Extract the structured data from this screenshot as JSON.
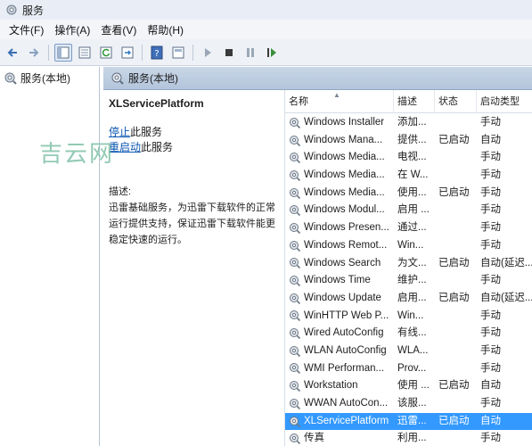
{
  "window": {
    "title": "服务"
  },
  "menu": [
    "文件(F)",
    "操作(A)",
    "查看(V)",
    "帮助(H)"
  ],
  "tree": {
    "root_label": "服务(本地)"
  },
  "pane_header": {
    "label": "服务(本地)"
  },
  "detail": {
    "service_name": "XLServicePlatform",
    "stop_link": "停止",
    "stop_suffix": "此服务",
    "restart_link": "重启动",
    "restart_suffix": "此服务",
    "desc_label": "描述:",
    "desc_text": "迅雷基础服务，为迅雷下载软件的正常运行提供支持，保证迅雷下载软件能更稳定快速的运行。"
  },
  "watermark": "吉云网",
  "table": {
    "columns": {
      "name": "名称",
      "desc": "描述",
      "status": "状态",
      "type": "启动类型"
    },
    "rows": [
      {
        "name": "Windows Installer",
        "desc": "添加...",
        "status": "",
        "type": "手动"
      },
      {
        "name": "Windows Mana...",
        "desc": "提供...",
        "status": "已启动",
        "type": "自动"
      },
      {
        "name": "Windows Media...",
        "desc": "电视...",
        "status": "",
        "type": "手动"
      },
      {
        "name": "Windows Media...",
        "desc": "在 W...",
        "status": "",
        "type": "手动"
      },
      {
        "name": "Windows Media...",
        "desc": "使用...",
        "status": "已启动",
        "type": "手动"
      },
      {
        "name": "Windows Modul...",
        "desc": "启用 ...",
        "status": "",
        "type": "手动"
      },
      {
        "name": "Windows Presen...",
        "desc": "通过...",
        "status": "",
        "type": "手动"
      },
      {
        "name": "Windows Remot...",
        "desc": "Win...",
        "status": "",
        "type": "手动"
      },
      {
        "name": "Windows Search",
        "desc": "为文...",
        "status": "已启动",
        "type": "自动(延迟..."
      },
      {
        "name": "Windows Time",
        "desc": "维护...",
        "status": "",
        "type": "手动"
      },
      {
        "name": "Windows Update",
        "desc": "启用...",
        "status": "已启动",
        "type": "自动(延迟..."
      },
      {
        "name": "WinHTTP Web P...",
        "desc": "Win...",
        "status": "",
        "type": "手动"
      },
      {
        "name": "Wired AutoConfig",
        "desc": "有线...",
        "status": "",
        "type": "手动"
      },
      {
        "name": "WLAN AutoConfig",
        "desc": "WLA...",
        "status": "",
        "type": "手动"
      },
      {
        "name": "WMI Performan...",
        "desc": "Prov...",
        "status": "",
        "type": "手动"
      },
      {
        "name": "Workstation",
        "desc": "使用 ...",
        "status": "已启动",
        "type": "自动"
      },
      {
        "name": "WWAN AutoCon...",
        "desc": "该服...",
        "status": "",
        "type": "手动"
      },
      {
        "name": "XLServicePlatform",
        "desc": "迅雷...",
        "status": "已启动",
        "type": "自动",
        "selected": true
      },
      {
        "name": "传真",
        "desc": "利用...",
        "status": "",
        "type": "手动"
      }
    ]
  }
}
